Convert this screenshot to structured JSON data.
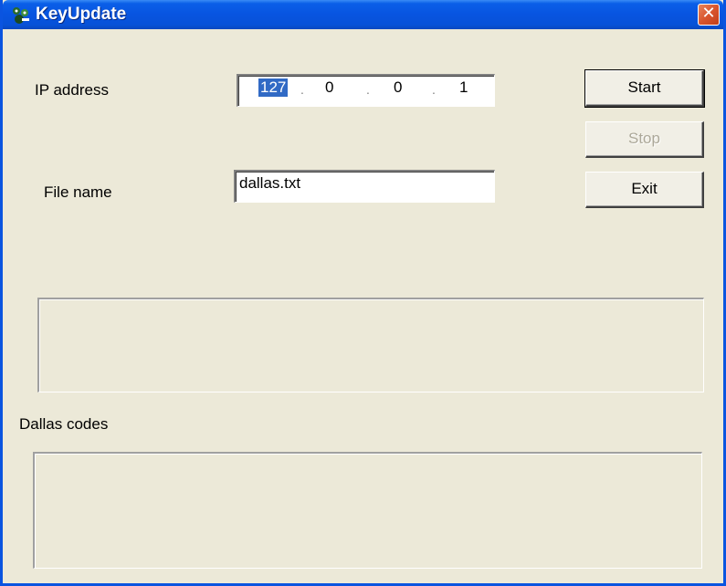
{
  "window": {
    "title": "KeyUpdate",
    "close_glyph": "✕",
    "icon": "keyupdate-app-icon"
  },
  "form": {
    "ip_label": "IP address",
    "ip_octets": [
      "127",
      "0",
      "0",
      "1"
    ],
    "ip_separator": ".",
    "file_label": "File name",
    "file_value": "dallas.txt",
    "codes_label": "Dallas codes"
  },
  "buttons": {
    "start": "Start",
    "stop": "Stop",
    "exit": "Exit"
  },
  "colors": {
    "titlebar": "#0854e0",
    "selection": "#316ac5",
    "face": "#ece9d8",
    "close": "#d9552e"
  }
}
